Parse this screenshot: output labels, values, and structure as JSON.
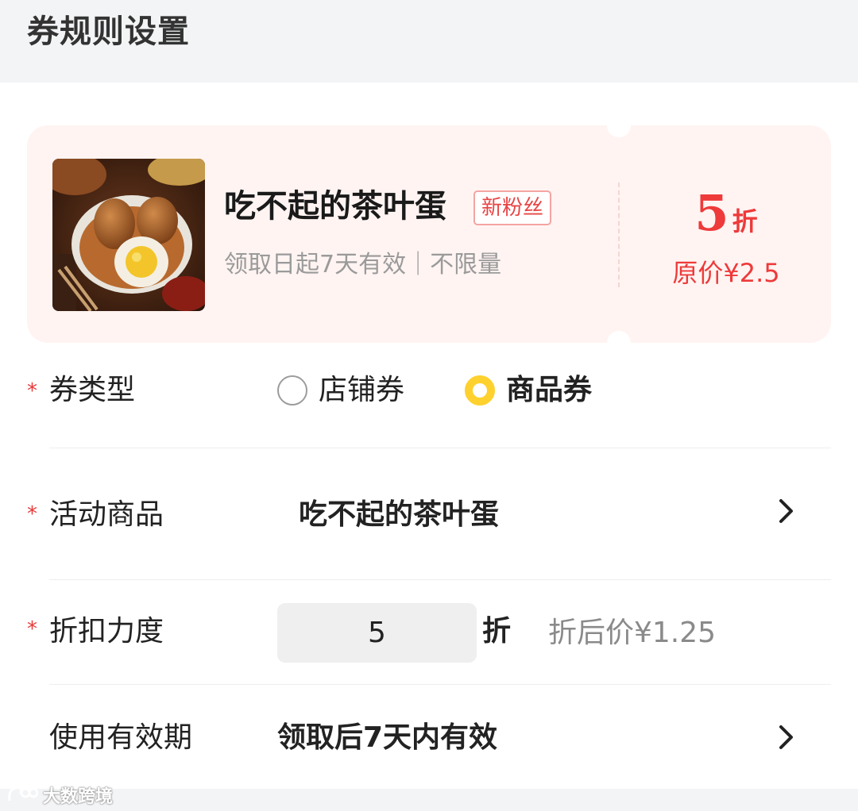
{
  "header": {
    "title": "券规则设置"
  },
  "coupon_preview": {
    "product_image_icon": "tea-egg-photo",
    "title": "吃不起的茶叶蛋",
    "tag": "新粉丝",
    "validity": "领取日起7天有效｜不限量",
    "discount_value": "5",
    "discount_unit": "折",
    "original_price": "原价¥2.5",
    "accent_color": "#ee3a3a",
    "background_color": "#fff4f2"
  },
  "form": {
    "required_mark": "*",
    "coupon_type": {
      "label": "券类型",
      "options": [
        {
          "label": "店铺券",
          "selected": false
        },
        {
          "label": "商品券",
          "selected": true
        }
      ],
      "selected_color": "#ffd12e"
    },
    "activity_product": {
      "label": "活动商品",
      "value": "吃不起的茶叶蛋",
      "icon": "chevron-right-icon"
    },
    "discount": {
      "label": "折扣力度",
      "value": "5",
      "unit": "折",
      "after_price": "折后价¥1.25"
    },
    "validity_period": {
      "label": "使用有效期",
      "value": "领取后7天内有效",
      "icon": "chevron-right-icon"
    }
  },
  "watermark": {
    "text": "大数跨境"
  }
}
